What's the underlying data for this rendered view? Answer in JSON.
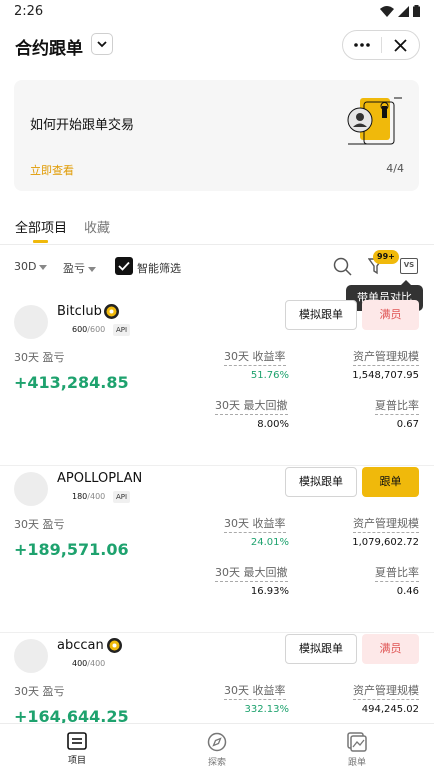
{
  "status": {
    "time": "2:26"
  },
  "header": {
    "title": "合约跟单"
  },
  "banner": {
    "title": "如何开始跟单交易",
    "link": "立即查看",
    "pager": "4/4"
  },
  "tabs": {
    "all": "全部项目",
    "favorites": "收藏"
  },
  "filters": {
    "period": "30D",
    "sort": "盈亏",
    "smart": "智能筛选",
    "badge": "99+",
    "vs": "VS"
  },
  "tooltip": "带单员对比",
  "cards": [
    {
      "name": "Bitclub",
      "members": "600",
      "capacity": "/600",
      "api": "API",
      "sim_label": "模拟跟单",
      "action_label": "满员",
      "pnl_label": "30天 盈亏",
      "pnl": "+413,284.85",
      "roi_label": "30天 收益率",
      "roi": "51.76%",
      "aum_label": "资产管理规模",
      "aum": "1,548,707.95",
      "mdd_label": "30天 最大回撤",
      "mdd": "8.00%",
      "sharpe_label": "夏普比率",
      "sharpe": "0.67"
    },
    {
      "name": "APOLLOPLAN",
      "members": "180",
      "capacity": "/400",
      "api": "API",
      "sim_label": "模拟跟单",
      "action_label": "跟单",
      "pnl_label": "30天 盈亏",
      "pnl": "+189,571.06",
      "roi_label": "30天 收益率",
      "roi": "24.01%",
      "aum_label": "资产管理规模",
      "aum": "1,079,602.72",
      "mdd_label": "30天 最大回撤",
      "mdd": "16.93%",
      "sharpe_label": "夏普比率",
      "sharpe": "0.46"
    },
    {
      "name": "abccan",
      "members": "400",
      "capacity": "/400",
      "sim_label": "模拟跟单",
      "action_label": "满员",
      "pnl_label": "30天 盈亏",
      "pnl": "+164,644.25",
      "roi_label": "30天 收益率",
      "roi": "332.13%",
      "aum_label": "资产管理规模",
      "aum": "494,245.02"
    }
  ],
  "bottom_nav": {
    "projects": "项目",
    "explore": "探索",
    "copy": "跟单"
  },
  "colors": {
    "accent": "#f0b90b",
    "profit": "#1ea26e",
    "full_bg": "#fde8e8",
    "full_text": "#e05656"
  }
}
